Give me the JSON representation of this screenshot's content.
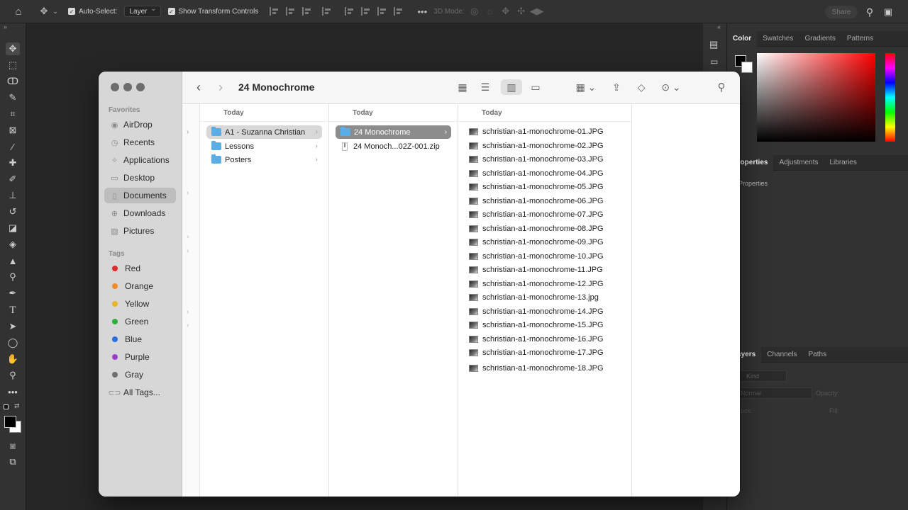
{
  "topbar": {
    "auto_select_label": "Auto-Select:",
    "layer_select_value": "Layer",
    "show_transform_label": "Show Transform Controls",
    "mode_3d_label": "3D Mode:",
    "share_label": "Share"
  },
  "panels": {
    "color_tabs": [
      "Color",
      "Swatches",
      "Gradients",
      "Patterns"
    ],
    "properties_tabs": [
      "Properties",
      "Adjustments",
      "Libraries"
    ],
    "properties_sub": "Properties",
    "layers_tabs": [
      "Layers",
      "Channels",
      "Paths"
    ],
    "layers_kind": "Kind",
    "layers_blend": "Normal",
    "layers_opacity_label": "Opacity:",
    "layers_lock_label": "Lock:",
    "layers_fill_label": "Fill:"
  },
  "finder": {
    "title": "24 Monochrome",
    "sidebar": {
      "favorites_label": "Favorites",
      "favorites": [
        {
          "label": "AirDrop",
          "icon": "airdrop-icon"
        },
        {
          "label": "Recents",
          "icon": "clock-icon"
        },
        {
          "label": "Applications",
          "icon": "applications-icon"
        },
        {
          "label": "Desktop",
          "icon": "desktop-icon"
        },
        {
          "label": "Documents",
          "icon": "document-icon"
        },
        {
          "label": "Downloads",
          "icon": "download-icon"
        },
        {
          "label": "Pictures",
          "icon": "pictures-icon"
        }
      ],
      "tags_label": "Tags",
      "tags": [
        {
          "label": "Red",
          "color": "#e02a2a"
        },
        {
          "label": "Orange",
          "color": "#f08a24"
        },
        {
          "label": "Yellow",
          "color": "#e8b325"
        },
        {
          "label": "Green",
          "color": "#2fae3c"
        },
        {
          "label": "Blue",
          "color": "#2a6fe0"
        },
        {
          "label": "Purple",
          "color": "#9b3fc4"
        },
        {
          "label": "Gray",
          "color": "#6e6e6e"
        }
      ],
      "all_tags_label": "All Tags..."
    },
    "columns": [
      {
        "header": "Today",
        "items": [
          "A1 - Suzanna Christian",
          "Lessons",
          "Posters"
        ]
      },
      {
        "header": "Today",
        "items": [
          "24 Monochrome",
          "24 Monoch...02Z-001.zip"
        ]
      },
      {
        "header": "Today",
        "items": [
          "schristian-a1-monochrome-01.JPG",
          "schristian-a1-monochrome-02.JPG",
          "schristian-a1-monochrome-03.JPG",
          "schristian-a1-monochrome-04.JPG",
          "schristian-a1-monochrome-05.JPG",
          "schristian-a1-monochrome-06.JPG",
          "schristian-a1-monochrome-07.JPG",
          "schristian-a1-monochrome-08.JPG",
          "schristian-a1-monochrome-09.JPG",
          "schristian-a1-monochrome-10.JPG",
          "schristian-a1-monochrome-11.JPG",
          "schristian-a1-monochrome-12.JPG",
          "schristian-a1-monochrome-13.jpg",
          "schristian-a1-monochrome-14.JPG",
          "schristian-a1-monochrome-15.JPG",
          "schristian-a1-monochrome-16.JPG",
          "schristian-a1-monochrome-17.JPG",
          "schristian-a1-monochrome-18.JPG"
        ]
      }
    ]
  }
}
